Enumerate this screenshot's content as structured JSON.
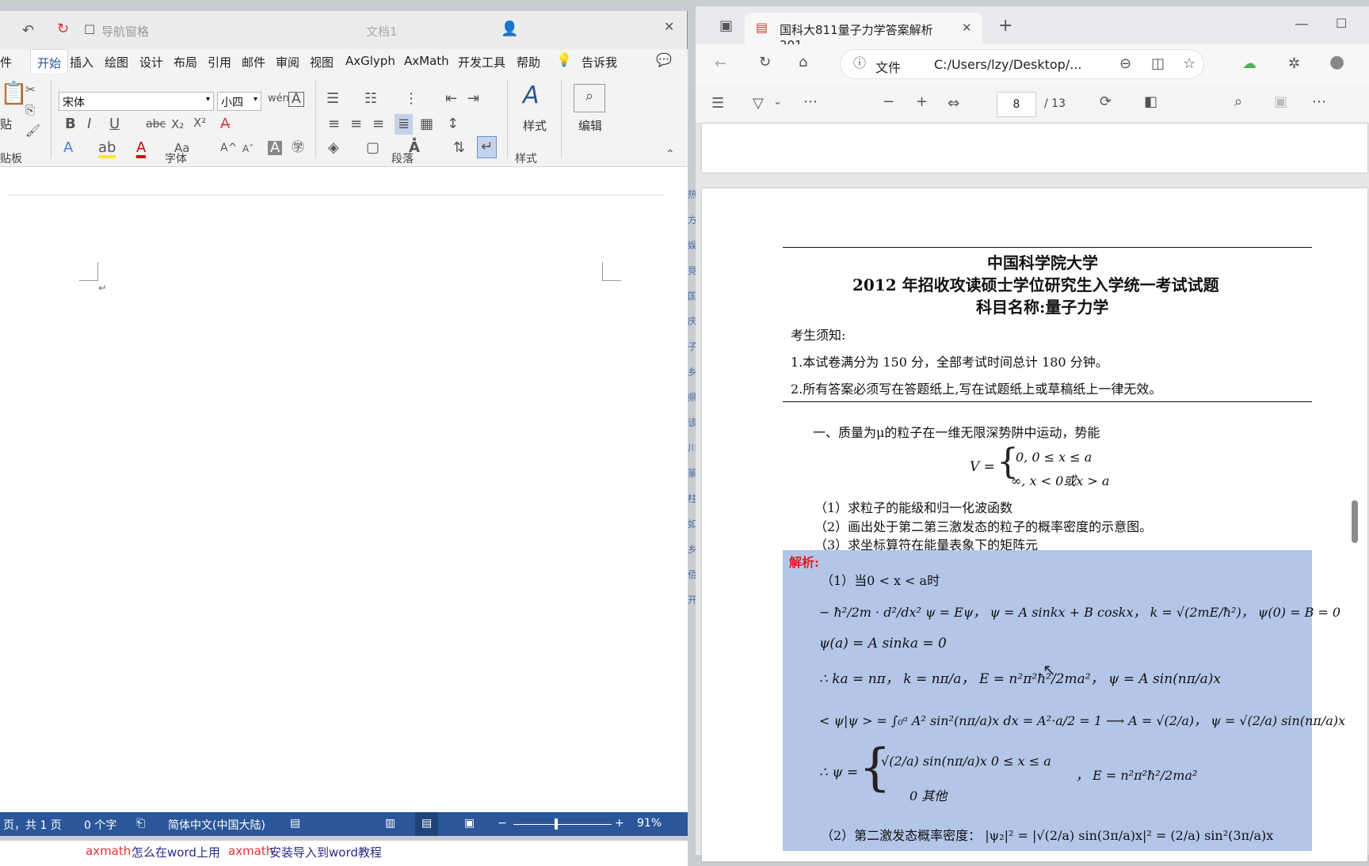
{
  "word": {
    "qat": {
      "autosave_label": "导航窗格",
      "doc_title": "文档1"
    },
    "menu": [
      "件",
      "开始",
      "插入",
      "绘图",
      "设计",
      "布局",
      "引用",
      "邮件",
      "审阅",
      "视图",
      "AxGlyph",
      "AxMath",
      "开发工具",
      "帮助",
      "告诉我"
    ],
    "ribbon": {
      "paste_label": "贴",
      "font_name": "宋体",
      "font_size": "小四",
      "styles_label": "样式",
      "edit_label": "编辑",
      "groups": [
        "贴板",
        "字体",
        "段落",
        "样式"
      ]
    },
    "status": {
      "page": "页，共 1 页",
      "words": "0 个字",
      "language": "简体中文(中国大陆)",
      "zoom": "91%"
    },
    "caption": {
      "part1": "axmath",
      "part2": "怎么在word上用",
      "part3": "axmath",
      "part4": "安装导入到word教程"
    }
  },
  "edge": {
    "tab_title": "国科大811量子力学答案解析201",
    "address_prefix": "文件",
    "address": "C:/Users/lzy/Desktop/...",
    "pdf": {
      "page_current": "8",
      "page_total": "/ 13"
    },
    "exam": {
      "title1": "中国科学院大学",
      "title2": "2012 年招收攻读硕士学位研究生入学统一考试试题",
      "title3": "科目名称:量子力学",
      "notice_head": "考生须知:",
      "notice1": "1.本试卷满分为 150 分，全部考试时间总计 180 分钟。",
      "notice2": "2.所有答案必须写在答题纸上,写在试题纸上或草稿纸上一律无效。",
      "q1": "一、质量为μ的粒子在一维无限深势阱中运动，势能",
      "potential_v": "V =",
      "case1": "0,      0 ≤ x ≤ a",
      "case2": "∞,  x < 0或x > a",
      "sub1": "（1）求粒子的能级和归一化波函数",
      "sub2": "（2）画出处于第二第三激发态的粒子的概率密度的示意图。",
      "sub3": "（3）求坐标算符在能量表象下的矩阵元",
      "answer_head": "解析:",
      "a1": "（1）当0 < x < a时",
      "eq1": "− ħ²/2m · d²/dx² ψ = Eψ，  ψ = A sinkx + B coskx，  k = √(2mE/ħ²)，  ψ(0) = B = 0",
      "eq2": "ψ(a) = A sinka = 0",
      "eq3": "∴ ka = nπ，  k = nπ/a，  E = n²π²ħ²/2ma²，  ψ = A sin(nπ/a)x",
      "eq4": "< ψ|ψ > = ∫₀ᵃ A² sin²(nπ/a)x dx = A²·a/2 = 1 ⟶ A = √(2/a)，  ψ = √(2/a) sin(nπ/a)x",
      "eq5a": "√(2/a) sin(nπ/a)x    0 ≤ x ≤ a",
      "eq5b": "0                       其他",
      "eq5c": "，  E = n²π²ħ²/2ma²",
      "eq5_lead": "∴ ψ =",
      "eq6": "（2）第二激发态概率密度：  |ψ₂|² = |√(2/a) sin(3π/a)x|² = (2/a) sin²(3π/a)x"
    }
  },
  "left_strip": [
    "热",
    "方",
    "娱",
    "竞",
    "国",
    "庆",
    "子",
    "乡",
    "県",
    "该",
    "川",
    "篆",
    "柱",
    "如",
    "乡",
    "佰",
    "开"
  ]
}
